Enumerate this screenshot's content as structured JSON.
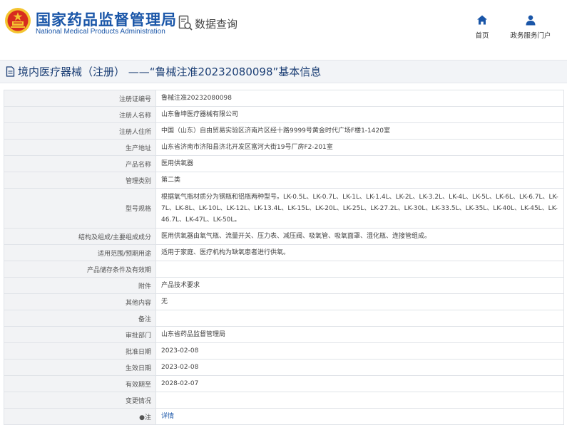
{
  "header": {
    "logo_cn": "国家药品监督管理局",
    "logo_en": "National Medical Products Administration",
    "data_query": "数据查询",
    "nav": [
      {
        "label": "首页",
        "icon": "home-icon"
      },
      {
        "label": "政务服务门户",
        "icon": "user-icon"
      }
    ]
  },
  "title": "境内医疗器械（注册） ——“鲁械注准20232080098”基本信息",
  "rows": [
    {
      "key": "注册证编号",
      "value": "鲁械注准20232080098"
    },
    {
      "key": "注册人名称",
      "value": "山东鲁坤医疗器械有限公司"
    },
    {
      "key": "注册人住所",
      "value": "中国（山东）自由贸易实验区济南片区经十路9999号黄金时代广场F楼1-1420室"
    },
    {
      "key": "生产地址",
      "value": "山东省济南市济阳县济北开发区富河大街19号厂房F2-201室"
    },
    {
      "key": "产品名称",
      "value": "医用供氧器"
    },
    {
      "key": "管理类别",
      "value": "第二类"
    },
    {
      "key": "型号规格",
      "value": "根据氧气瓶材质分为钢瓶和铝瓶两种型号。LK-0.5L、LK-0.7L、LK-1L、LK-1.4L、LK-2L、LK-3.2L、LK-4L、LK-5L、LK-6L、LK-6.7L、LK-7L、LK-8L、LK-10L、LK-12L、LK-13.4L、LK-15L、LK-20L、LK-25L、LK-27.2L、LK-30L、LK-33.5L、LK-35L、LK-40L、LK-45L、LK-46.7L、LK-47L、LK-50L。"
    },
    {
      "key": "结构及组成/主要组成成分",
      "value": "医用供氧器由氧气瓶、流量开关、压力表、减压阀、吸氧管、吸氧面罩、湿化瓶、连接管组成。"
    },
    {
      "key": "适用范围/预期用途",
      "value": "适用于家庭、医疗机构为缺氧患者进行供氧。"
    },
    {
      "key": "产品储存条件及有效期",
      "value": ""
    },
    {
      "key": "附件",
      "value": "产品技术要求"
    },
    {
      "key": "其他内容",
      "value": "无"
    },
    {
      "key": "备注",
      "value": ""
    },
    {
      "key": "审批部门",
      "value": "山东省药品监督管理局"
    },
    {
      "key": "批准日期",
      "value": "2023-02-08"
    },
    {
      "key": "生效日期",
      "value": "2023-02-08"
    },
    {
      "key": "有效期至",
      "value": "2028-02-07"
    },
    {
      "key": "变更情况",
      "value": ""
    },
    {
      "key": "●注",
      "value": "详情"
    }
  ],
  "colors": {
    "brand_blue": "#1a56a8",
    "title_blue": "#1c3f75",
    "label_bg": "#f2f3f5",
    "emblem_red": "#d72b1f",
    "emblem_gold": "#f4c430"
  }
}
